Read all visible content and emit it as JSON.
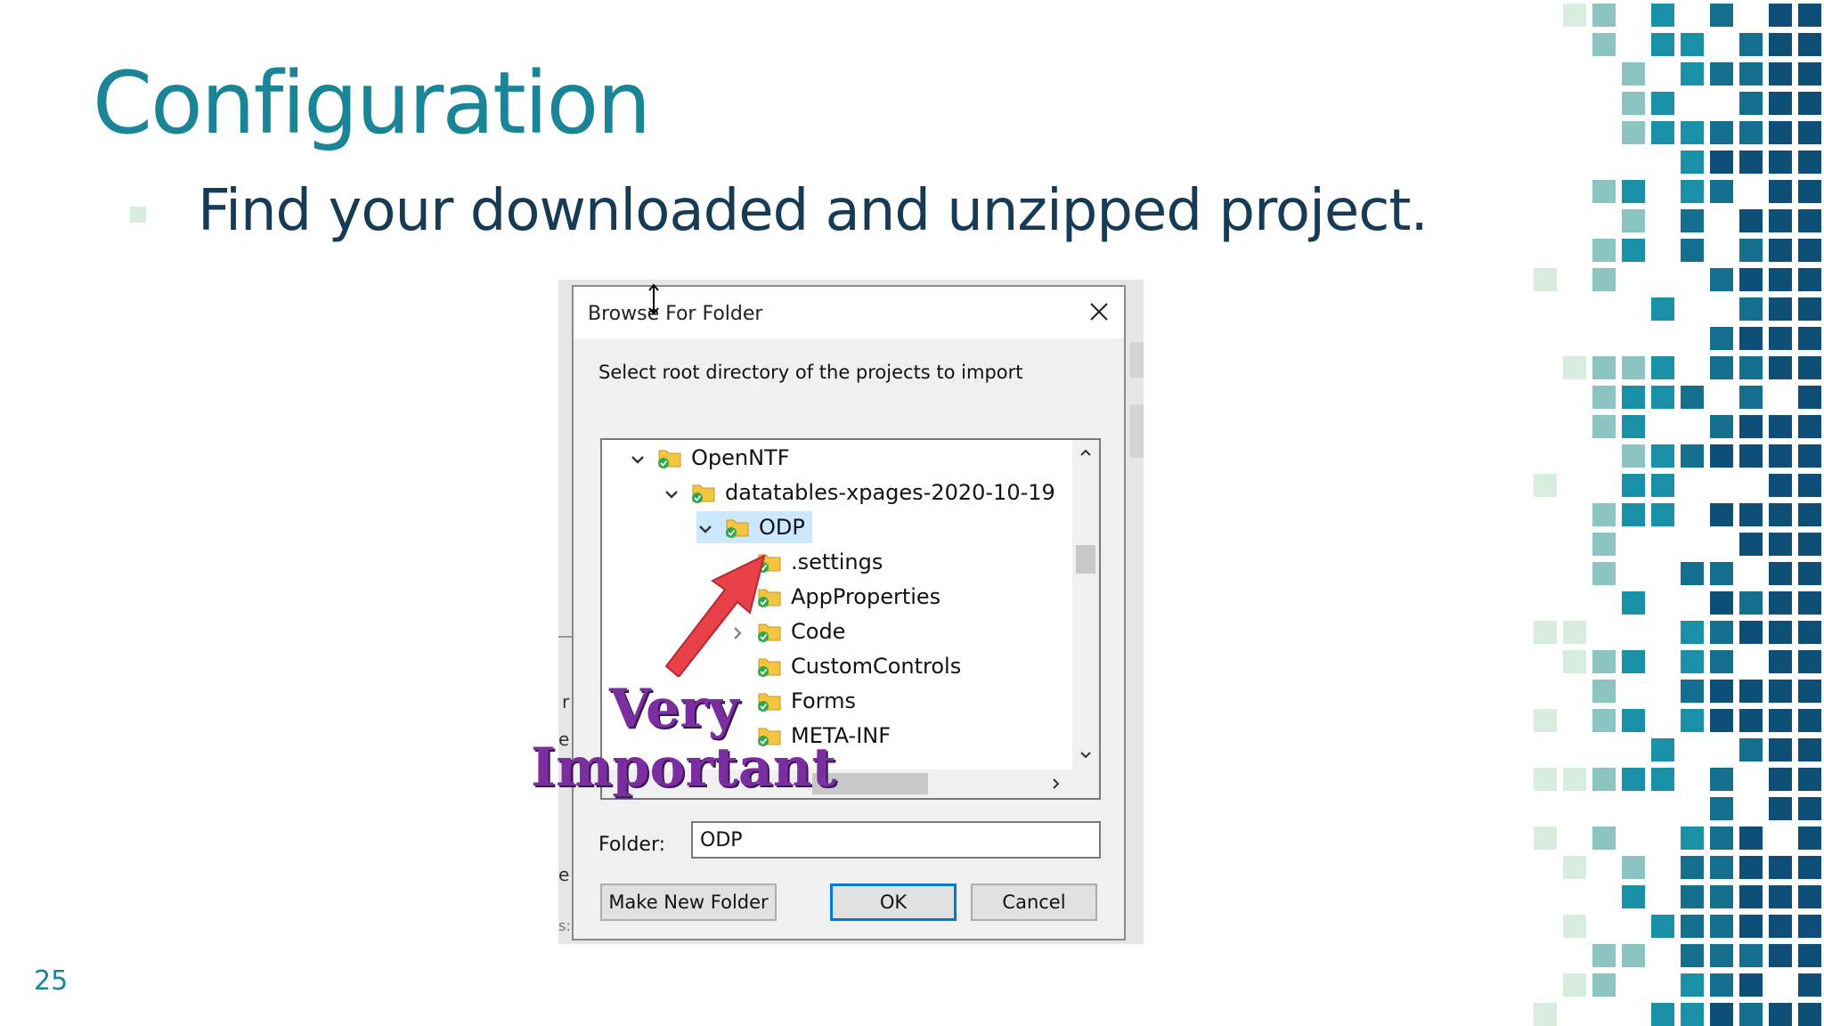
{
  "slide": {
    "title": "Configuration",
    "bullet": "Find your downloaded and unzipped project.",
    "page_number": "25"
  },
  "colors": {
    "title": "#1a8597",
    "body_text": "#173a55",
    "mosaic_palette": [
      "#d8ecdf",
      "#8cc4c2",
      "#1a8fa8",
      "#15708f",
      "#0e4f78"
    ],
    "dialog_bg": "#f0f0f0",
    "selection": "#cce8ff",
    "ok_border": "#0078d7",
    "annotation_purple": "#7a2ea0",
    "annotation_arrow": "#e8414a"
  },
  "dialog": {
    "title": "Browse For Folder",
    "instruction": "Select root directory of the projects to import",
    "tree": [
      {
        "label": "OpenNTF",
        "expanded": true,
        "icon": "folder-synced-icon"
      },
      {
        "label": "datatables-xpages-2020-10-19",
        "expanded": true,
        "icon": "folder-synced-icon"
      },
      {
        "label": "ODP",
        "expanded": true,
        "selected": true,
        "icon": "folder-synced-icon"
      },
      {
        "label": ".settings",
        "icon": "folder-synced-icon"
      },
      {
        "label": "AppProperties",
        "icon": "folder-synced-icon"
      },
      {
        "label": "Code",
        "collapsed": true,
        "icon": "folder-synced-icon"
      },
      {
        "label": "CustomControls",
        "icon": "folder-synced-icon"
      },
      {
        "label": "Forms",
        "icon": "folder-synced-icon"
      },
      {
        "label": "META-INF",
        "icon": "folder-synced-icon"
      }
    ],
    "folder_label": "Folder:",
    "folder_value": "ODP",
    "buttons": {
      "make_new_folder": "Make New Folder",
      "ok": "OK",
      "cancel": "Cancel"
    }
  },
  "annotation": {
    "line1": "Very",
    "line2": "Important"
  },
  "background_window_fragments": [
    "r",
    "e",
    "e",
    "s:"
  ]
}
